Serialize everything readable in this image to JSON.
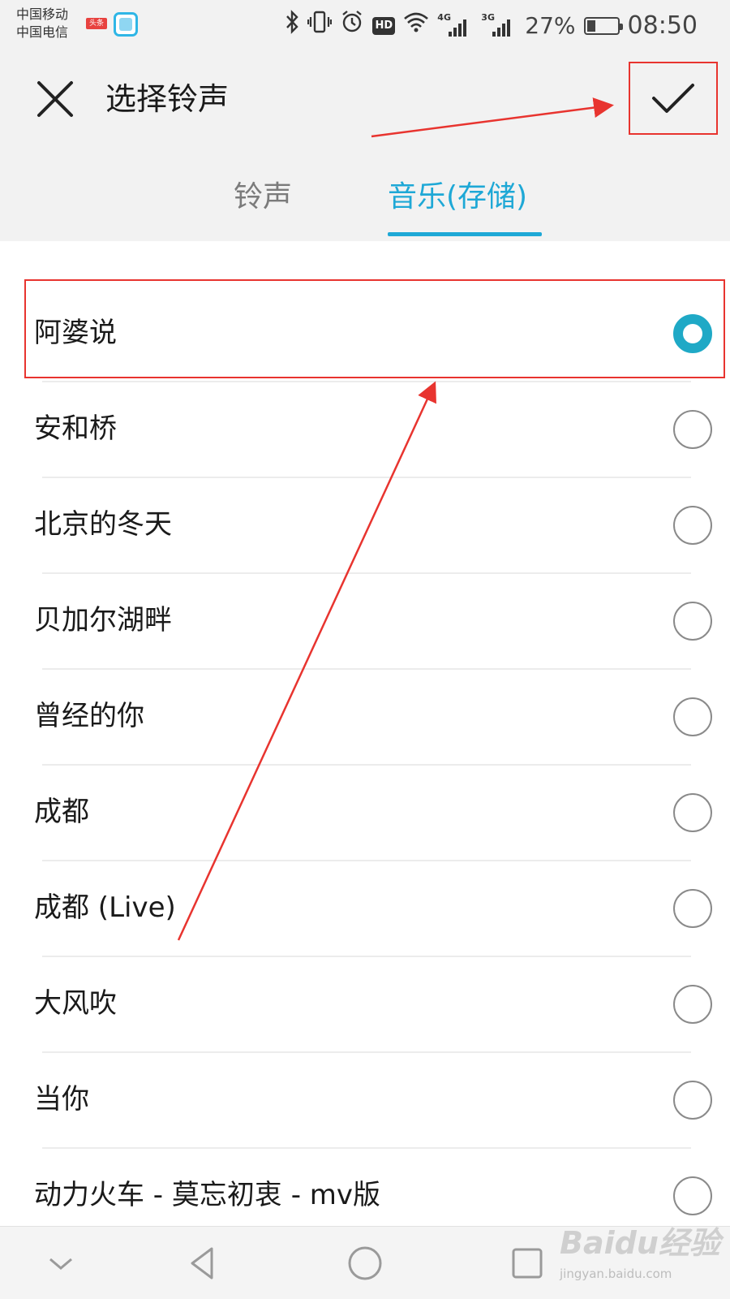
{
  "status_bar": {
    "carrier_1": "中国移动",
    "carrier_2": "中国电信",
    "badge_text": "头条",
    "hd_label": "HD",
    "signal_1_label": "4G",
    "signal_2_label": "3G",
    "battery_percent": "27%",
    "battery_level": 0.27,
    "time": "08:50",
    "icons": [
      "bluetooth-icon",
      "vibrate-icon",
      "alarm-icon",
      "hd-icon",
      "wifi-icon",
      "signal-4g-icon",
      "signal-3g-icon",
      "battery-icon"
    ]
  },
  "header": {
    "title": "选择铃声",
    "close_icon": "close-icon",
    "confirm_icon": "check-icon"
  },
  "tabs": [
    {
      "label": "铃声",
      "active": false
    },
    {
      "label": "音乐(存储)",
      "active": true
    }
  ],
  "songs": [
    {
      "label": "阿婆说",
      "selected": true
    },
    {
      "label": "安和桥",
      "selected": false
    },
    {
      "label": "北京的冬天",
      "selected": false
    },
    {
      "label": "贝加尔湖畔",
      "selected": false
    },
    {
      "label": "曾经的你",
      "selected": false
    },
    {
      "label": "成都",
      "selected": false
    },
    {
      "label": "成都 (Live)",
      "selected": false
    },
    {
      "label": "大风吹",
      "selected": false
    },
    {
      "label": "当你",
      "selected": false
    },
    {
      "label": "动力火车 - 莫忘初衷 - mv版",
      "selected": false
    }
  ],
  "nav_bar": {
    "icons": [
      "collapse-icon",
      "back-icon",
      "home-icon",
      "recents-icon"
    ]
  },
  "watermark": {
    "main": "Baidu经验",
    "sub": "jingyan.baidu.com"
  },
  "colors": {
    "accent": "#1ea8d6",
    "radio_selected": "#1fa9c6",
    "annotation_red": "#e8342f",
    "background_gray": "#f2f2f2"
  }
}
